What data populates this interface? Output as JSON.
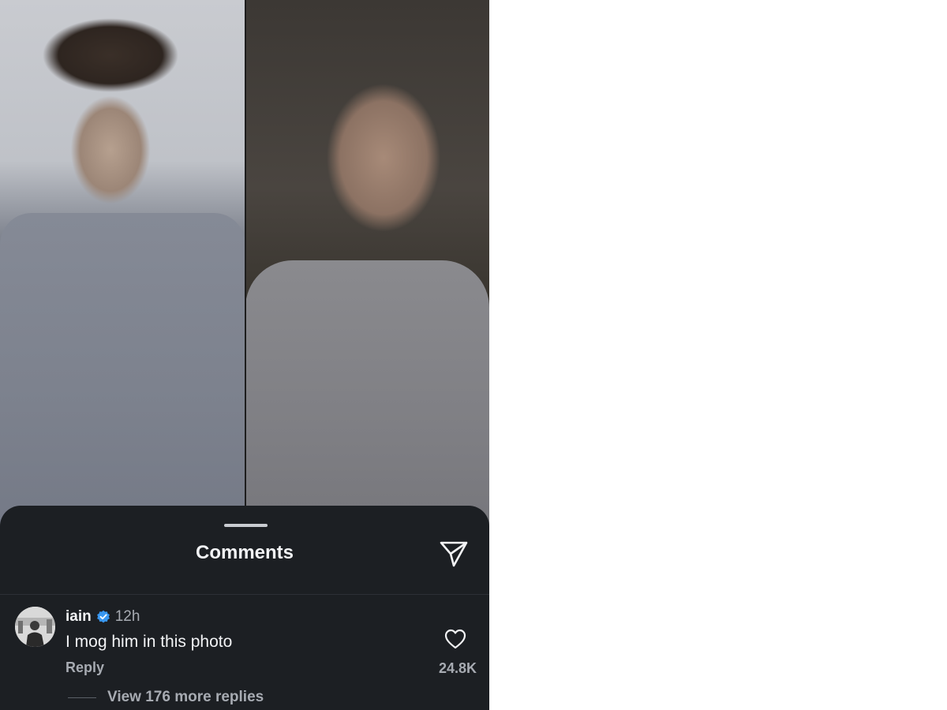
{
  "sheet": {
    "title": "Comments",
    "share_icon": "paper-plane-icon"
  },
  "comment": {
    "username": "iain",
    "verified_icon": "verified-badge-icon",
    "time": "12h",
    "text": "I mog him in this photo",
    "reply_label": "Reply",
    "like_icon": "heart-outline-icon",
    "like_count": "24.8K",
    "more_replies": "View 176 more replies"
  },
  "colors": {
    "sheet_bg": "#1c1f23",
    "text_primary": "#f2f3f5",
    "text_secondary": "#a7abb2",
    "verified_blue": "#3897f0"
  }
}
